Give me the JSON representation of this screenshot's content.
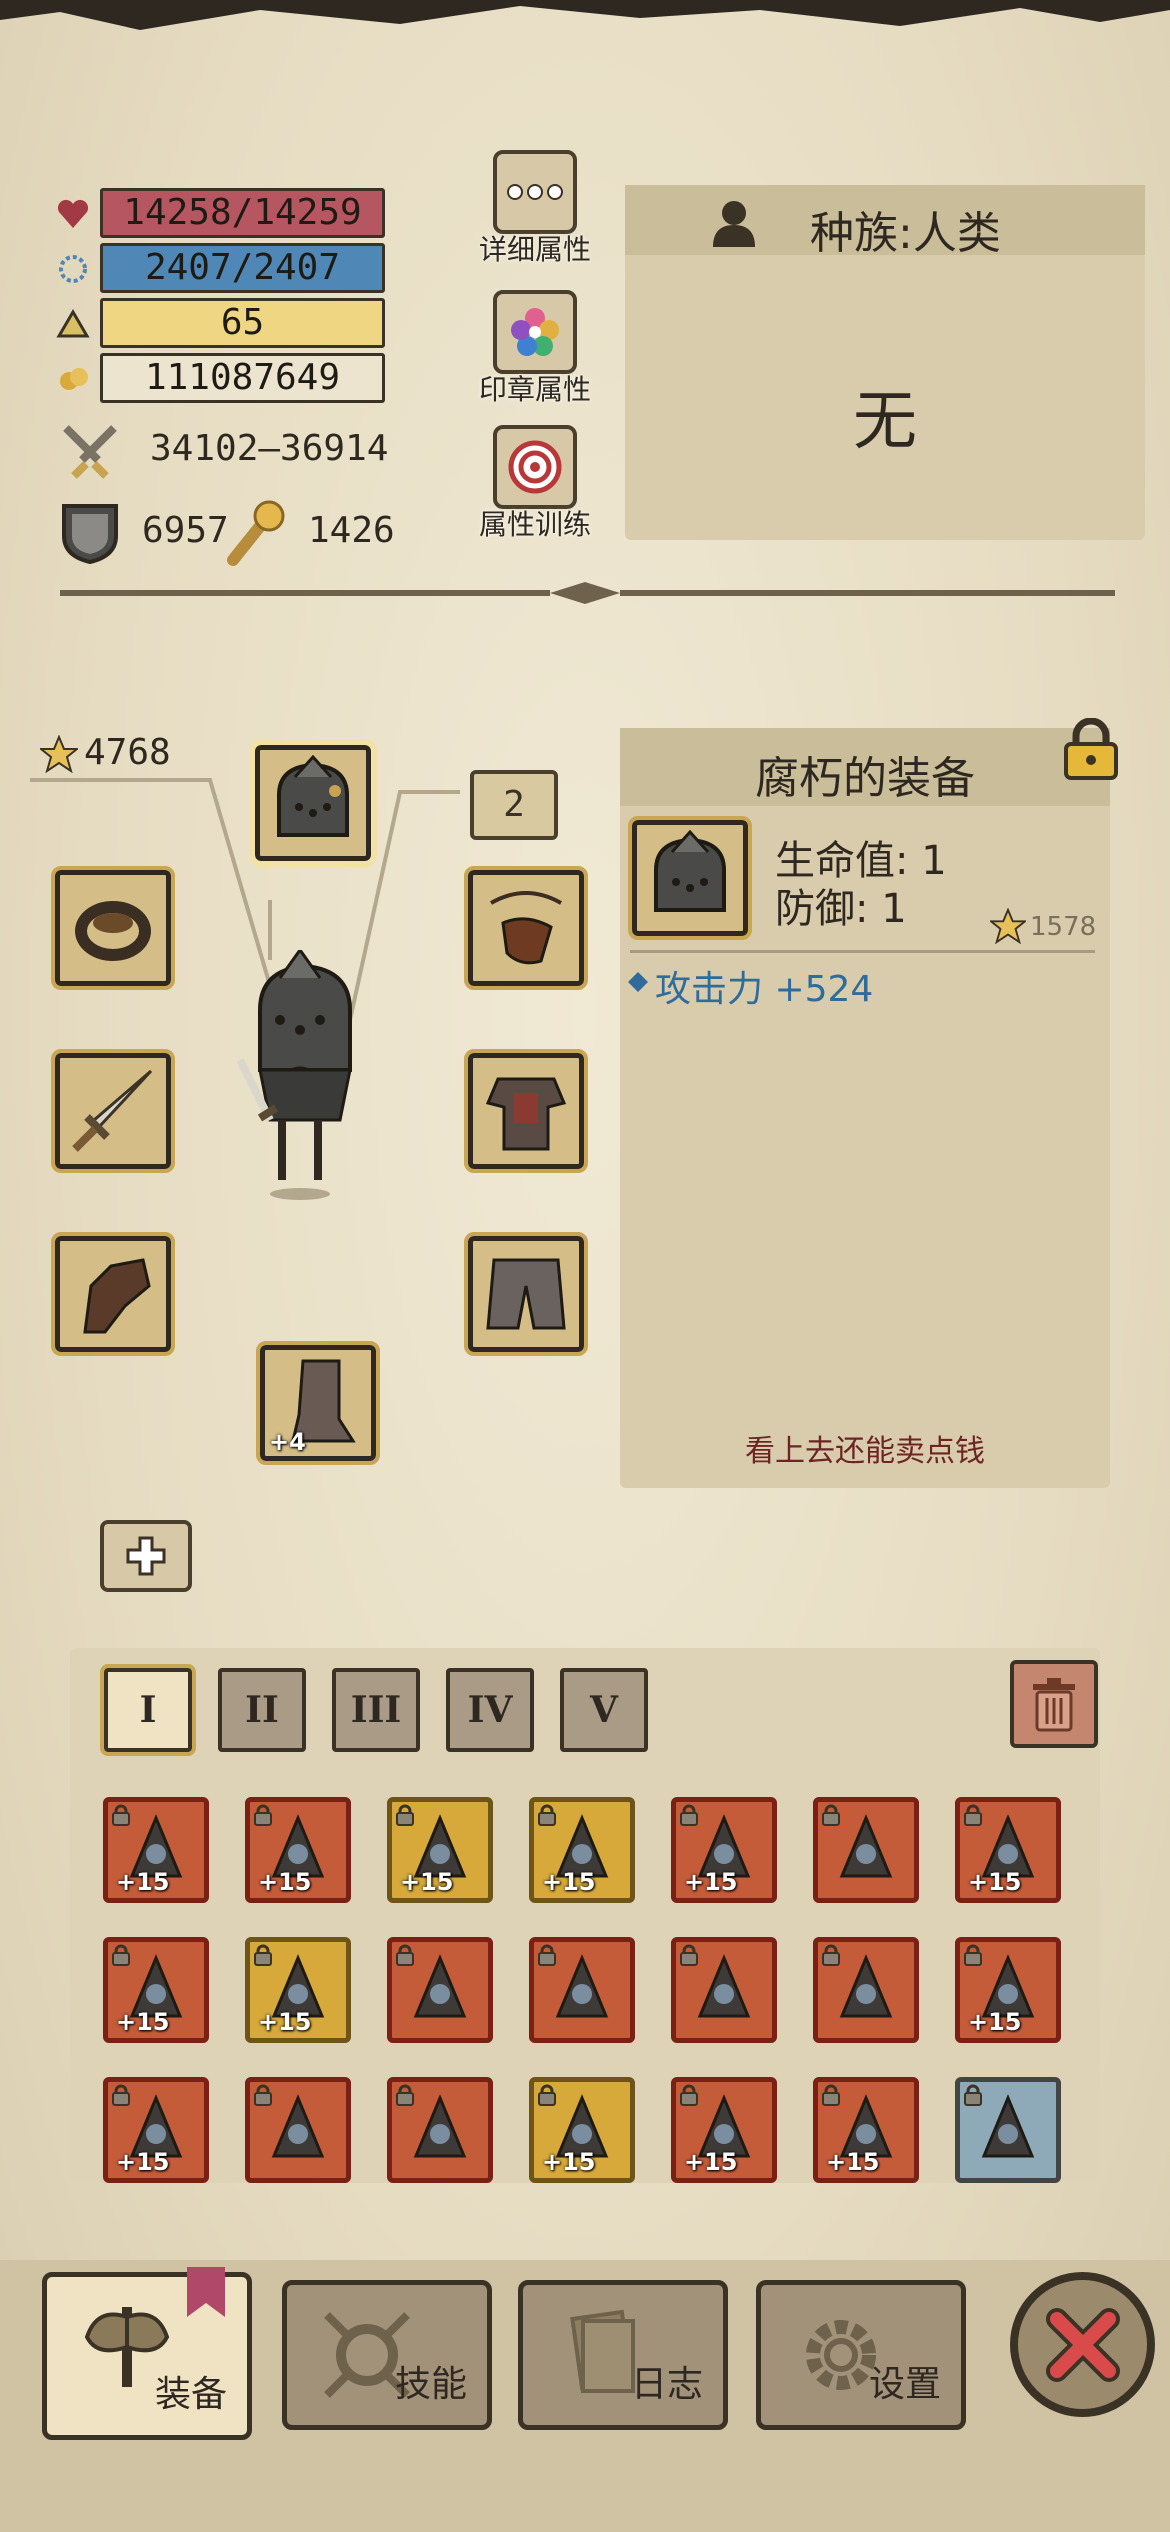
{
  "stats": {
    "hp": "14258/14259",
    "mp": "2407/2407",
    "level": "65",
    "gold": "111087649",
    "attack": "34102–36914",
    "defense": "6957",
    "strength": "1426"
  },
  "side_buttons": {
    "detail": "详细属性",
    "seal": "印章属性",
    "training": "属性训练"
  },
  "race": {
    "title": "种族:人类",
    "value": "无"
  },
  "equipment": {
    "star_total": "4768",
    "badge": "2",
    "boots_plus": "+4"
  },
  "detail": {
    "title": "腐朽的装备",
    "hp_stat": "生命值: 1",
    "def_stat": "防御: 1",
    "star": "1578",
    "attack_bonus": "攻击力 +524",
    "flavor": "看上去还能卖点钱"
  },
  "inventory": {
    "tabs": [
      "I",
      "II",
      "III",
      "IV",
      "V"
    ],
    "active_tab": "I",
    "items": [
      {
        "plus": "+15",
        "rarity": "red"
      },
      {
        "plus": "+15",
        "rarity": "red"
      },
      {
        "plus": "+15",
        "rarity": "gold"
      },
      {
        "plus": "+15",
        "rarity": "gold"
      },
      {
        "plus": "+15",
        "rarity": "red"
      },
      {
        "plus": "",
        "rarity": "red"
      },
      {
        "plus": "+15",
        "rarity": "red"
      },
      {
        "plus": "+15",
        "rarity": "red"
      },
      {
        "plus": "+15",
        "rarity": "gold"
      },
      {
        "plus": "",
        "rarity": "red"
      },
      {
        "plus": "",
        "rarity": "red"
      },
      {
        "plus": "",
        "rarity": "red"
      },
      {
        "plus": "",
        "rarity": "red"
      },
      {
        "plus": "+15",
        "rarity": "red"
      },
      {
        "plus": "+15",
        "rarity": "red"
      },
      {
        "plus": "",
        "rarity": "red"
      },
      {
        "plus": "",
        "rarity": "red"
      },
      {
        "plus": "+15",
        "rarity": "gold"
      },
      {
        "plus": "+15",
        "rarity": "red"
      },
      {
        "plus": "+15",
        "rarity": "red"
      },
      {
        "plus": "",
        "rarity": "blue"
      }
    ]
  },
  "nav": {
    "equip": "装备",
    "skill": "技能",
    "log": "日志",
    "settings": "设置"
  },
  "colors": {
    "hp_bar": "#b65660",
    "mp_bar": "#4f87b6",
    "level_bar": "#eed682",
    "attack_text": "#2f6c9c",
    "flavor_text": "#6c2424"
  }
}
